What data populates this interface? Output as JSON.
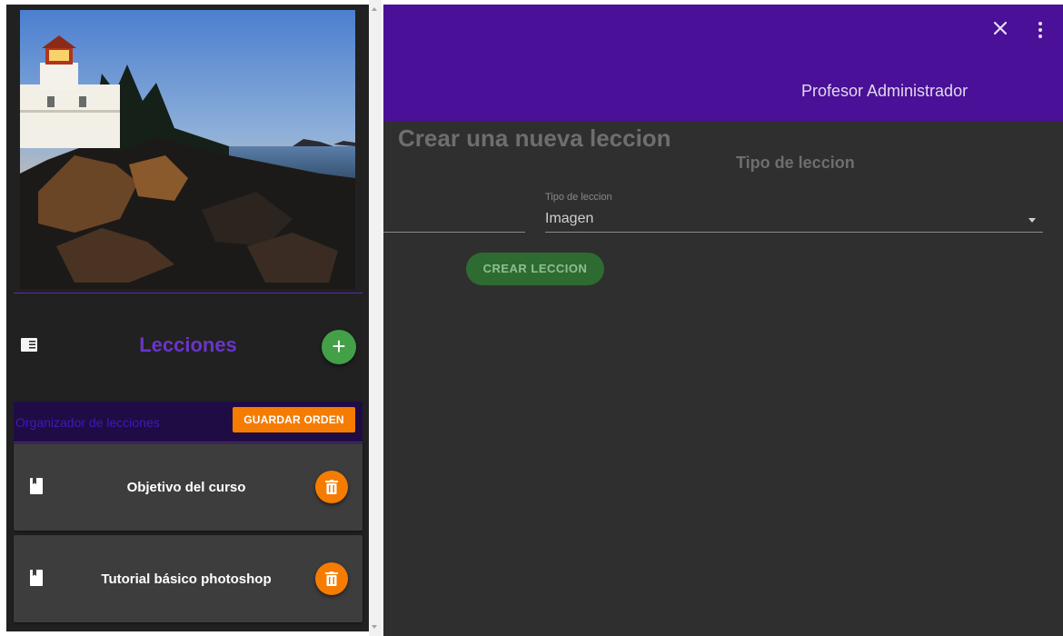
{
  "sidebar": {
    "cover_image_alt": "Lighthouse on rocky coast at sunset",
    "lessons_title": "Lecciones",
    "add_button_label": "+",
    "organizer_label": "Organizador de lecciones",
    "save_order_label": "GUARDAR ORDEN",
    "lessons": [
      {
        "title": "Objetivo del curso"
      },
      {
        "title": "Tutorial básico photoshop"
      }
    ]
  },
  "header": {
    "close_icon": "close-icon",
    "menu_icon": "more-vert-icon",
    "user_name": "Profesor Administrador"
  },
  "main": {
    "page_title": "Crear una nueva leccion",
    "section_title": "Tipo de leccion",
    "type_field": {
      "label": "Tipo de leccion",
      "value": "Imagen"
    },
    "create_button_label": "CREAR LECCION"
  },
  "colors": {
    "header": "#4a1098",
    "accent_purple": "#6a35c9",
    "orange": "#f57c00",
    "green": "#43a047",
    "dark_bg": "#2f2f2f",
    "sidebar_bg": "#212121"
  }
}
